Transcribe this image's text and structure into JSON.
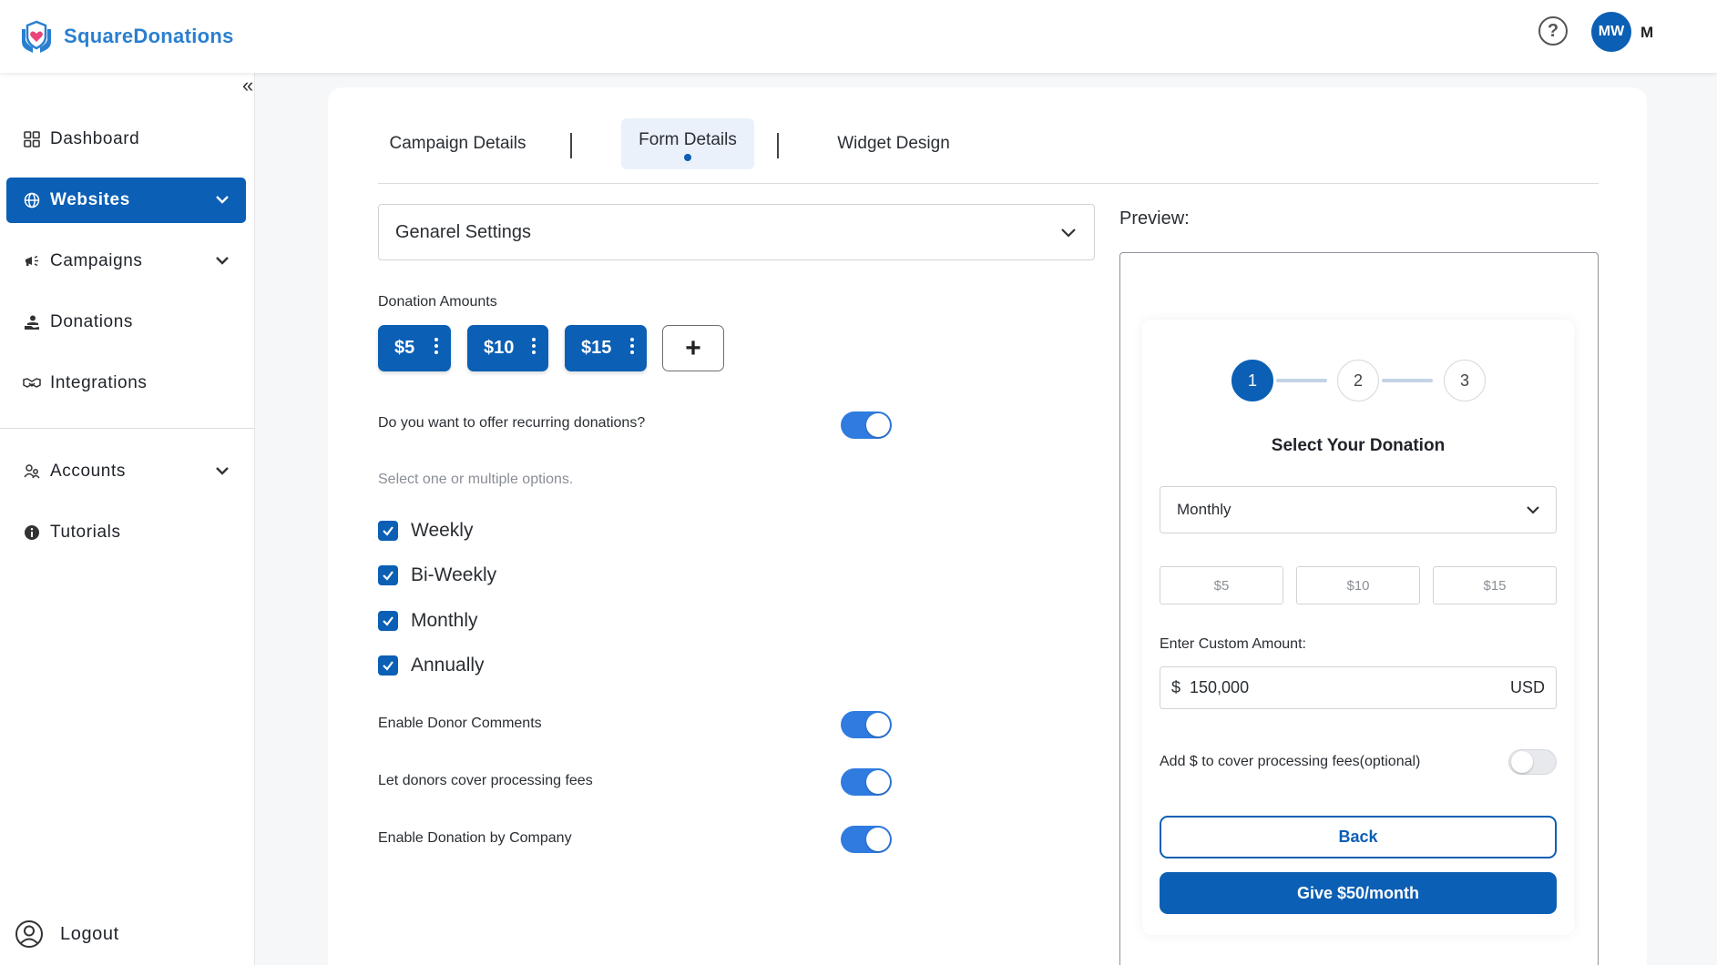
{
  "app": {
    "name": "SquareDonations",
    "brand_color": "#0b5fb4",
    "logo_icon": "heart-hands-icon"
  },
  "header": {
    "help_icon": "?",
    "avatar_initials": "MW",
    "user_name": "M"
  },
  "sidebar": {
    "collapse_icon": "«",
    "items": [
      {
        "label": "Dashboard",
        "icon": "grid-icon"
      },
      {
        "label": "Websites",
        "icon": "globe-icon",
        "active": true,
        "expandable": true
      },
      {
        "label": "Campaigns",
        "icon": "megaphone-icon",
        "expandable": true
      },
      {
        "label": "Donations",
        "icon": "donor-icon"
      },
      {
        "label": "Integrations",
        "icon": "handshake-icon"
      },
      {
        "label": "Accounts",
        "icon": "users-icon",
        "expandable": true
      },
      {
        "label": "Tutorials",
        "icon": "info-icon"
      }
    ],
    "logout_label": "Logout"
  },
  "tabs": [
    {
      "label": "Campaign Details"
    },
    {
      "label": "Form Details",
      "active": true
    },
    {
      "label": "Widget Design"
    }
  ],
  "form": {
    "section_select": "Genarel Settings",
    "donation_amounts_label": "Donation Amounts",
    "amounts": [
      "$5",
      "$10",
      "$15"
    ],
    "add_amount_icon": "+",
    "recurring_question": "Do you want to offer recurring donations?",
    "recurring_enabled": true,
    "options_hint": "Select one or multiple options.",
    "frequency_options": [
      {
        "label": "Weekly",
        "checked": true
      },
      {
        "label": "Bi-Weekly",
        "checked": true
      },
      {
        "label": "Monthly",
        "checked": true
      },
      {
        "label": "Annually",
        "checked": true
      }
    ],
    "toggles": [
      {
        "label": "Enable Donor Comments",
        "on": true
      },
      {
        "label": "Let donors cover processing fees",
        "on": true
      },
      {
        "label": "Enable Donation by Company",
        "on": true
      }
    ]
  },
  "preview": {
    "title": "Preview:",
    "steps": [
      "1",
      "2",
      "3"
    ],
    "active_step": 1,
    "heading": "Select Your Donation",
    "frequency_value": "Monthly",
    "amounts": [
      "$5",
      "$10",
      "$15"
    ],
    "custom_amount_label": "Enter Custom Amount:",
    "currency_symbol": "$",
    "custom_amount_value": "150,000",
    "currency_code": "USD",
    "fee_label": "Add $ to cover processing fees(optional)",
    "fee_toggle_on": false,
    "back_label": "Back",
    "give_label": "Give $50/month"
  }
}
